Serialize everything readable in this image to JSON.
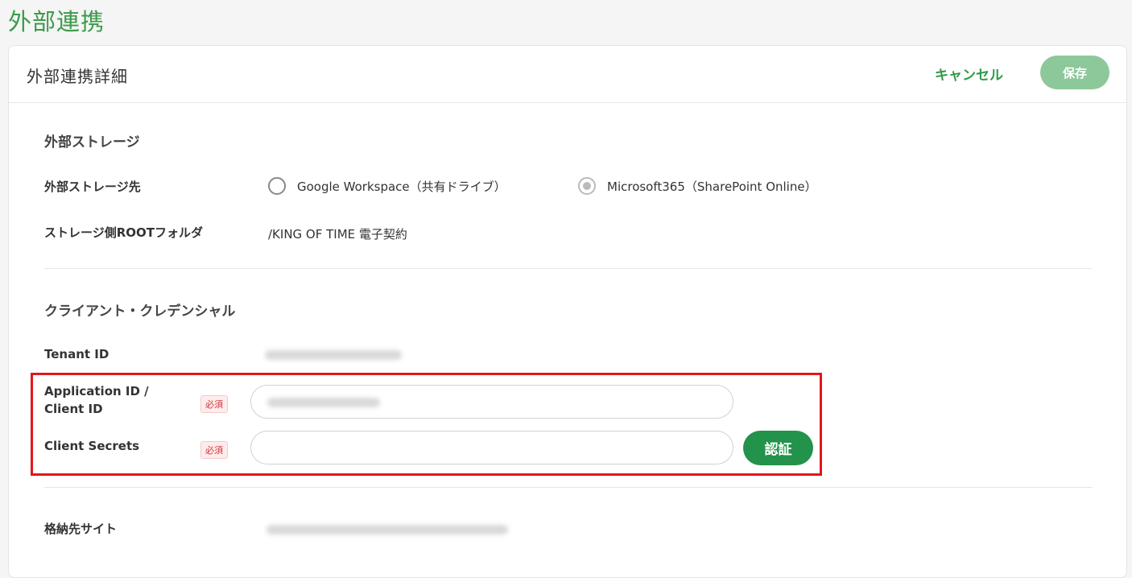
{
  "page": {
    "title": "外部連携"
  },
  "header": {
    "title": "外部連携詳細",
    "cancel_label": "キャンセル",
    "save_label": "保存"
  },
  "storage": {
    "section_title": "外部ストレージ",
    "destination_label": "外部ストレージ先",
    "options": [
      {
        "label": "Google Workspace（共有ドライブ）",
        "selected": false
      },
      {
        "label": "Microsoft365（SharePoint Online）",
        "selected": true
      }
    ],
    "root_folder_label": "ストレージ側ROOTフォルダ",
    "root_folder_value": "/KING OF TIME 電子契約"
  },
  "credential": {
    "section_title": "クライアント・クレデンシャル",
    "tenant_label": "Tenant ID",
    "app_id_label_line1": "Application ID /",
    "app_id_label_line2": "Client ID",
    "secret_label": "Client Secrets",
    "required_badge": "必須",
    "auth_label": "認証"
  },
  "site": {
    "label": "格納先サイト"
  },
  "colors": {
    "accent": "#2f9a48",
    "accent_light": "#8dc89a",
    "required": "#d2333a",
    "highlight": "#e3161b"
  }
}
